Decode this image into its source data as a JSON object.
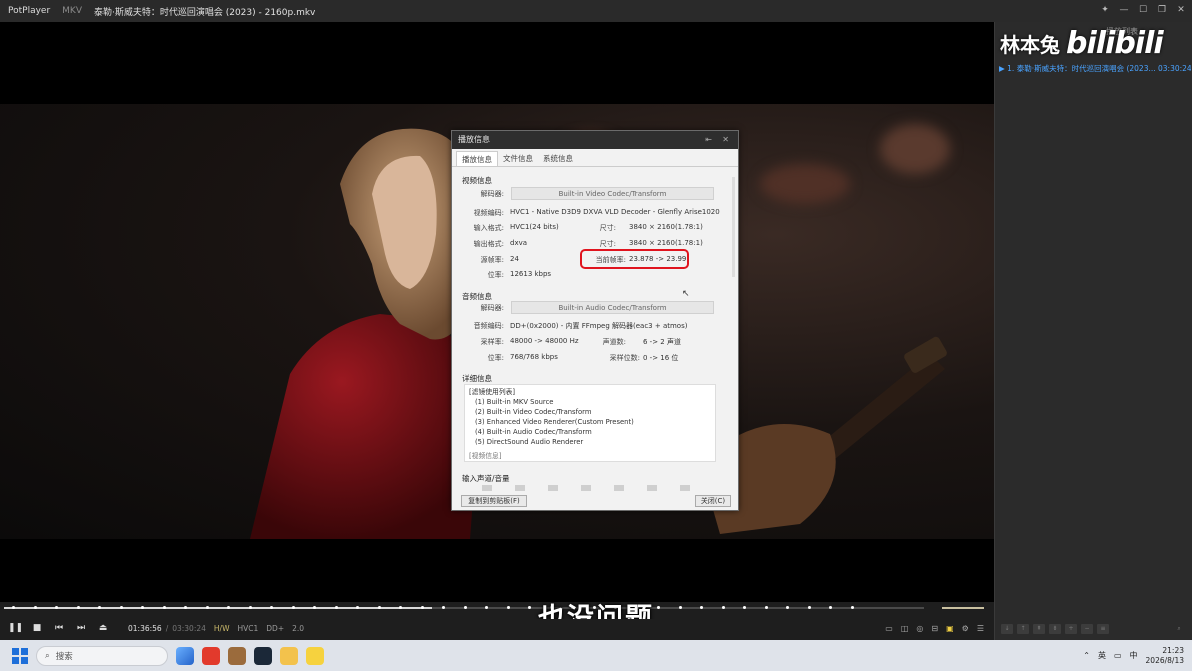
{
  "window": {
    "app_name": "PotPlayer",
    "format": "MKV",
    "title": "泰勒·斯威夫特：时代巡回演唱会 (2023) - 2160p.mkv"
  },
  "window_controls": [
    "pin",
    "minimize",
    "maximize",
    "restore",
    "close"
  ],
  "watermark": {
    "name": "林本兔",
    "brand": "bilibili"
  },
  "playlist": {
    "tabs": [
      "播放列表"
    ],
    "item": "▶ 1. 泰勒·斯威夫特：时代巡回演唱会 (2023...  03:30:24"
  },
  "subtitle": "也没问题",
  "controls": {
    "current_time": "01:36:56",
    "duration": "03:30:24",
    "tags": [
      "H/W",
      "HVC1",
      "DD+",
      "2.0"
    ],
    "progress_fraction": 0.465,
    "volume_fraction": 1.0
  },
  "dialog": {
    "title": "播放信息",
    "tabs": [
      "播放信息",
      "文件信息",
      "系统信息"
    ],
    "active_tab": 0,
    "video": {
      "section": "视频信息",
      "decoder_label": "解码器:",
      "decoder": "Built-in Video Codec/Transform",
      "codec_label": "视频编码:",
      "codec": "HVC1 - Native D3D9 DXVA VLD Decoder - Glenfly Arise1020",
      "input_label": "输入格式:",
      "input": "HVC1(24 bits)",
      "size_label": "尺寸:",
      "input_size": "3840 × 2160(1.78:1)",
      "output_label": "输出格式:",
      "output": "dxva",
      "output_size": "3840 × 2160(1.78:1)",
      "src_fps_label": "源帧率:",
      "src_fps": "24",
      "cur_fps_label": "当前帧率:",
      "cur_fps": "23.878 -> 23.99",
      "bitrate_label": "位率:",
      "bitrate": "12613 kbps"
    },
    "audio": {
      "section": "音频信息",
      "decoder_label": "解码器:",
      "decoder": "Built-in Audio Codec/Transform",
      "codec_label": "音频编码:",
      "codec": "DD+(0x2000) - 内置 FFmpeg 解码器(eac3 + atmos)",
      "samplerate_label": "采样率:",
      "samplerate": "48000 -> 48000 Hz",
      "channels_label": "声道数:",
      "channels": "6 -> 2 声道",
      "bitrate_label": "位率:",
      "bitrate": "768/768 kbps",
      "bits_label": "采样位数:",
      "bits": "0 -> 16 位"
    },
    "details": {
      "section": "详细信息",
      "list_title": "[滤镜使用列表]",
      "filters": [
        "(1) Built-in MKV Source",
        "(2) Built-in Video Codec/Transform",
        "(3) Enhanced Video Renderer(Custom Present)",
        "(4) Built-in Audio Codec/Transform",
        "(5) DirectSound Audio Renderer"
      ],
      "cut_off": "[视频信息]"
    },
    "input_section": "输入声道/音量",
    "copy_button": "复制到剪贴板(F)",
    "close_button": "关闭(C)"
  },
  "taskbar": {
    "search_placeholder": "搜索",
    "ime": "英",
    "ime2": "中",
    "time": "21:23",
    "date": "2026/8/13"
  }
}
